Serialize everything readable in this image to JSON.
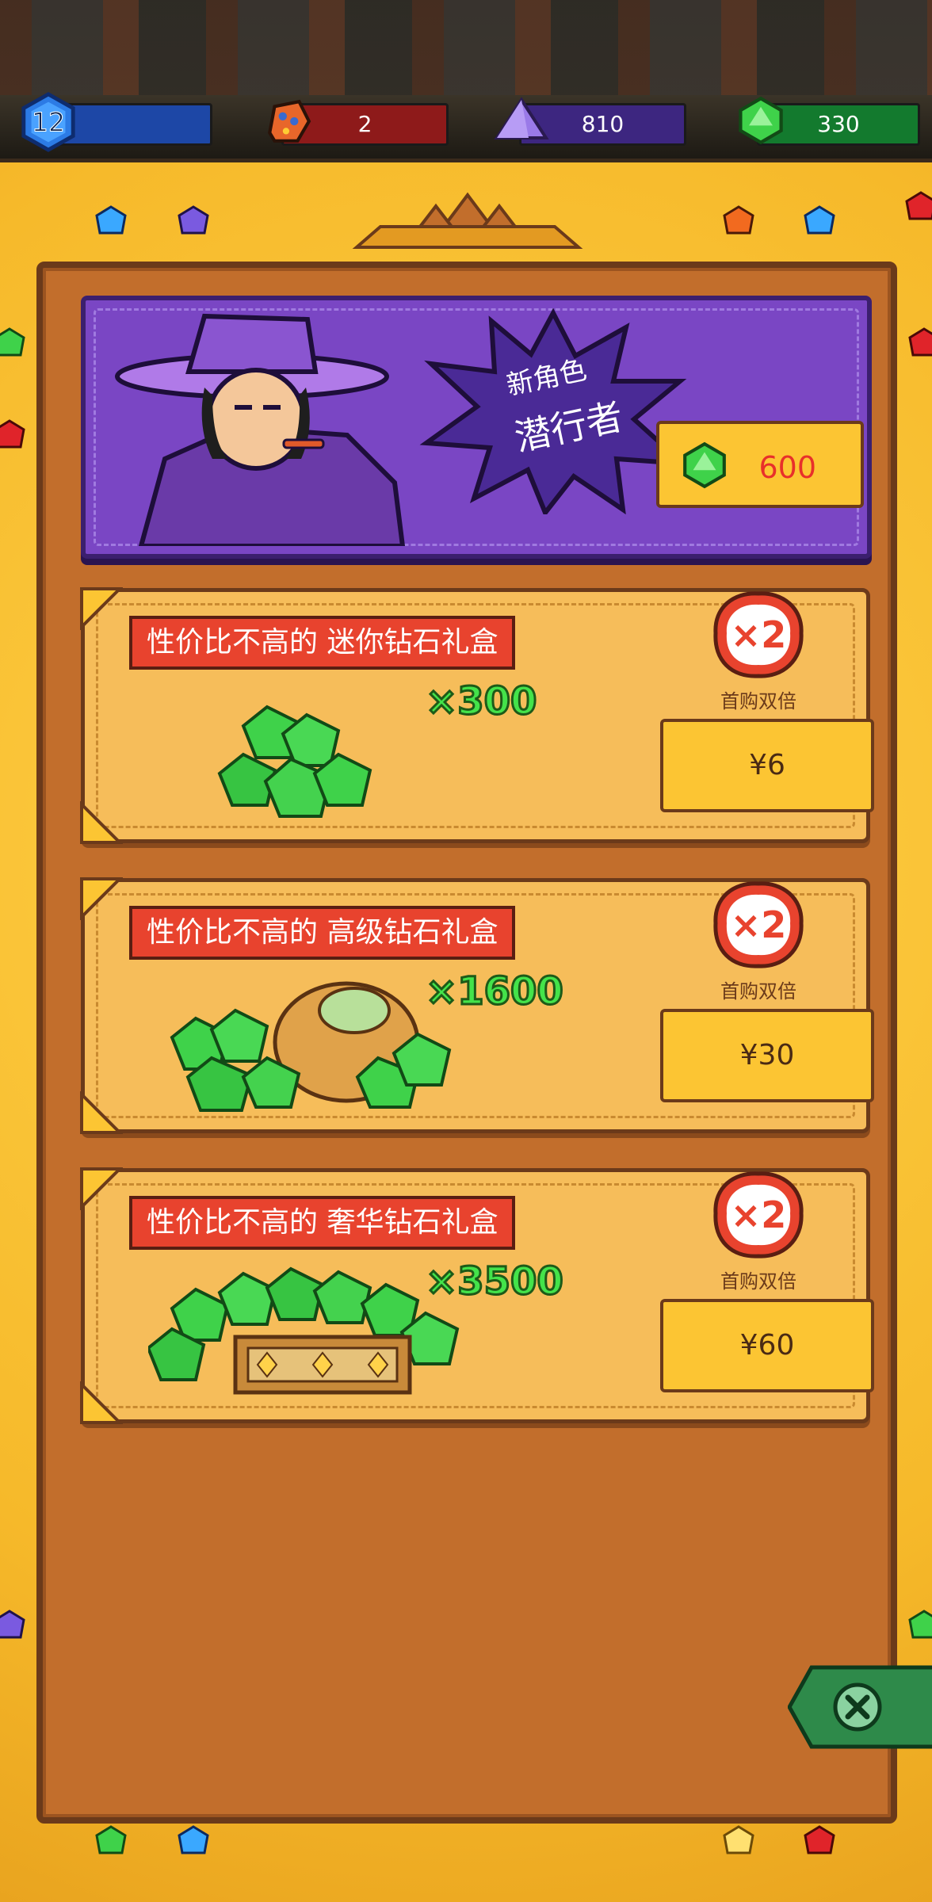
{
  "topbar": {
    "level": "12",
    "resources": [
      {
        "name": "red-stone",
        "value": "2",
        "color": "#8e1a1a"
      },
      {
        "name": "purple-crystal",
        "value": "810",
        "color": "#3d2680"
      },
      {
        "name": "green-gem",
        "value": "330",
        "color": "#137a2e"
      }
    ],
    "level_bar_color": "#1d47a6"
  },
  "hero_offer": {
    "line1": "新角色",
    "line2": "潜行者",
    "price": "600",
    "price_icon": "green-gem-icon"
  },
  "packs": [
    {
      "title": "性价比不高的 迷你钻石礼盒",
      "quantity": "×300",
      "badge": "×2",
      "badge_label": "首购双倍",
      "price": "¥6"
    },
    {
      "title": "性价比不高的 高级钻石礼盒",
      "quantity": "×1600",
      "badge": "×2",
      "badge_label": "首购双倍",
      "price": "¥30"
    },
    {
      "title": "性价比不高的 奢华钻石礼盒",
      "quantity": "×3500",
      "badge": "×2",
      "badge_label": "首购双倍",
      "price": "¥60"
    }
  ],
  "colors": {
    "accent_gem": "#3fd24a",
    "banner": "#e8432e",
    "price_tag": "#fcc533",
    "frame": "#f6b92a"
  }
}
